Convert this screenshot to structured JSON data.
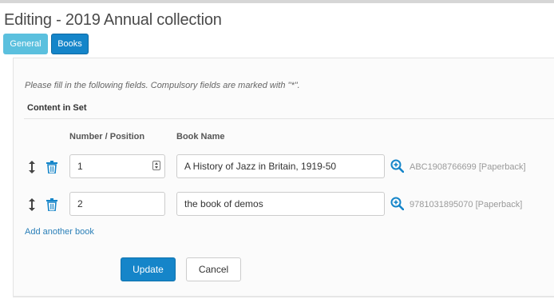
{
  "page": {
    "title": "Editing - 2019 Annual collection"
  },
  "tabs": [
    {
      "label": "General"
    },
    {
      "label": "Books"
    }
  ],
  "form": {
    "instructions": "Please fill in the following fields. Compulsory fields are marked with \"*\".",
    "section_title": "Content in Set",
    "columns": {
      "number": "Number / Position",
      "book": "Book Name"
    },
    "rows": [
      {
        "position": "1",
        "book_name": "A History of Jazz in Britain, 1919-50",
        "isbn": "ABC1908766699 [Paperback]"
      },
      {
        "position": "2",
        "book_name": "the book of demos",
        "isbn": "9781031895070 [Paperback]"
      }
    ],
    "add_link": "Add another book"
  },
  "actions": {
    "update": "Update",
    "cancel": "Cancel"
  },
  "colors": {
    "primary": "#1585c9",
    "info": "#5bc0de",
    "link": "#2a7fb8"
  },
  "icons": [
    "move-icon",
    "trash-icon",
    "spin-icon",
    "zoom-in-icon"
  ]
}
